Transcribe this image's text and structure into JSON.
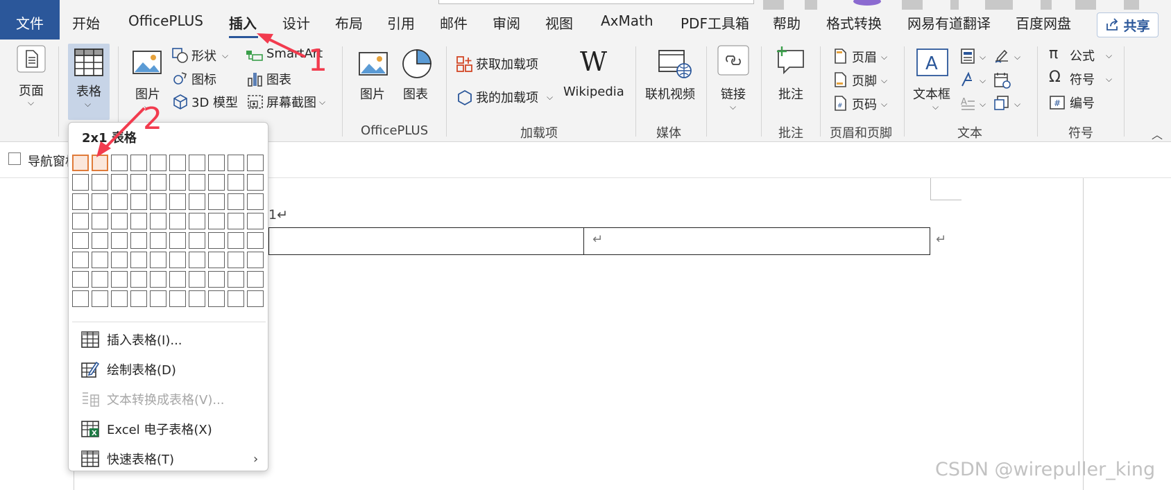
{
  "menubar": {
    "tabs": [
      "文件",
      "开始",
      "OfficePLUS",
      "插入",
      "设计",
      "布局",
      "引用",
      "邮件",
      "审阅",
      "视图",
      "AxMath",
      "PDF工具箱",
      "帮助",
      "格式转换",
      "网易有道翻译",
      "百度网盘"
    ],
    "share_label": "共享",
    "active_tab": "插入",
    "accent": "#2b579a"
  },
  "ribbon": {
    "pages": {
      "label": "页面"
    },
    "table": {
      "label": "表格"
    },
    "illustrations": {
      "picture": "图片",
      "shapes": "形状",
      "icons": "图标",
      "model3d": "3D 模型",
      "smartart": "SmartArt",
      "chart": "图表",
      "screenshot": "屏幕截图"
    },
    "officeplus": {
      "picture": "图片",
      "chart": "图表",
      "group": "OfficePLUS"
    },
    "addins": {
      "get": "获取加载项",
      "mine": "我的加载项",
      "wikipedia": "Wikipedia",
      "group": "加载项"
    },
    "media": {
      "video": "联机视频",
      "group": "媒体"
    },
    "links": {
      "label": "链接"
    },
    "comments": {
      "label": "批注",
      "group": "批注"
    },
    "headerfooter": {
      "header": "页眉",
      "footer": "页脚",
      "pagenum": "页码",
      "group": "页眉和页脚"
    },
    "text": {
      "textbox": "文本框",
      "group": "文本"
    },
    "symbols": {
      "equation": "公式",
      "symbol": "符号",
      "number": "编号",
      "group": "符号"
    }
  },
  "navpane": {
    "label": "导航窗格"
  },
  "dropdown": {
    "grid_title": "2x1 表格",
    "grid_cols": 10,
    "grid_rows": 8,
    "selected_cols": 2,
    "selected_rows": 1,
    "items": [
      {
        "label": "插入表格(I)...",
        "icon": "table-grid-icon",
        "disabled": false
      },
      {
        "label": "绘制表格(D)",
        "icon": "draw-table-icon",
        "disabled": false
      },
      {
        "label": "文本转换成表格(V)...",
        "icon": "text-to-table-icon",
        "disabled": true
      },
      {
        "label": "Excel 电子表格(X)",
        "icon": "excel-icon",
        "disabled": false
      },
      {
        "label": "快速表格(T)",
        "icon": "quick-table-icon",
        "disabled": false
      }
    ]
  },
  "document": {
    "line_text": "1↵",
    "return_mark": "↵"
  },
  "annotations": {
    "one": "1",
    "two": "2",
    "color": "#f23b4e"
  },
  "watermark": "CSDN @wirepuller_king"
}
